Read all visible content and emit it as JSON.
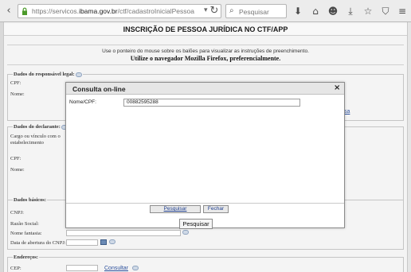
{
  "browser": {
    "url_prefix": "https://servicos.",
    "url_domain": "ibama.gov.br",
    "url_path": "/ctf/cadastroInicialPessoa",
    "search_placeholder": "Pesquisar"
  },
  "page": {
    "title": "INSCRIÇÃO DE PESSOA JURÍDICA NO CTF/APP",
    "instructions_line1": "Use o ponteiro do mouse sobre os balões para visualizar as instruções de preenchimento.",
    "instructions_line2": "Utilize o navegador Mozilla Firefox, preferencialmente.",
    "sections": {
      "responsavel": {
        "legend": "Dados do responsável legal:",
        "cpf_label": "CPF:",
        "nome_label": "Nome:"
      },
      "declarante": {
        "legend": "Dados do declarante:",
        "cargo_label_line1": "Cargo ou vínculo com o",
        "cargo_label_line2": "estabelecimento",
        "cpf_label": "CPF:",
        "nome_label": "Nome:"
      },
      "basicos": {
        "legend": "Dados básicos:",
        "cnpj_label": "CNPJ:",
        "razao_label": "Razão Social:",
        "fantasia_label": "Nome fantasia:",
        "abertura_label": "Data de abertura do CNPJ:"
      },
      "enderecos": {
        "legend": "Endereços:",
        "cep_label": "CEP:",
        "consultar_link": "Consultar"
      }
    },
    "bg_link_fragment": "sa"
  },
  "dialog": {
    "title": "Consulta on-line",
    "field_label": "Nome/CPF:",
    "field_value": "00882595288",
    "pesquisar_label": "Pesquisar",
    "fechar_label": "Fechar",
    "tooltip": "Pesquisar"
  }
}
